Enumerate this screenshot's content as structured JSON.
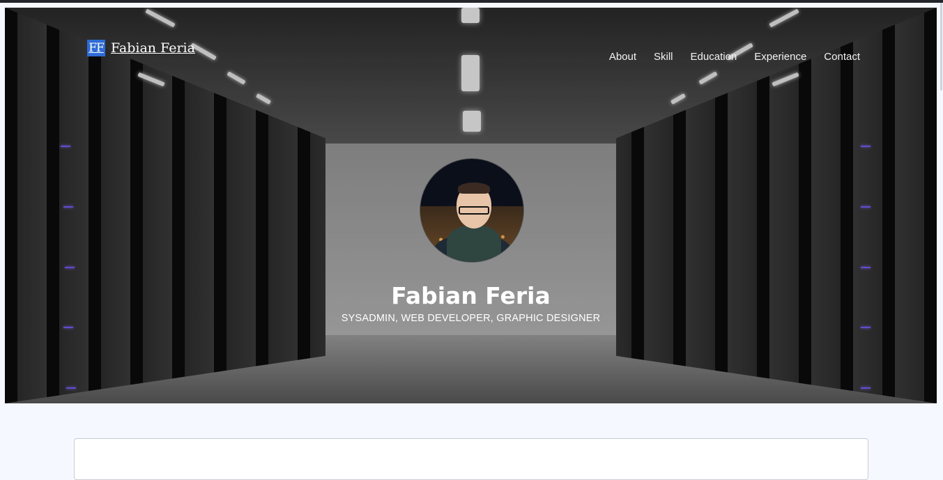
{
  "brand": {
    "logo_text": "FF",
    "name": "Fabian Feria"
  },
  "nav": {
    "items": [
      {
        "label": "About"
      },
      {
        "label": "Skill"
      },
      {
        "label": "Education"
      },
      {
        "label": "Experience"
      },
      {
        "label": "Contact"
      }
    ]
  },
  "hero": {
    "name": "Fabian Feria",
    "subtitle": "SYSADMIN, WEB DEVELOPER, GRAPHIC DESIGNER",
    "background_icon": "server-room-image",
    "avatar_icon": "profile-photo"
  },
  "colors": {
    "page_bg": "#f5f8fe",
    "brand_logo_bg": "#2e6bd6",
    "text_on_hero": "#ffffff"
  }
}
